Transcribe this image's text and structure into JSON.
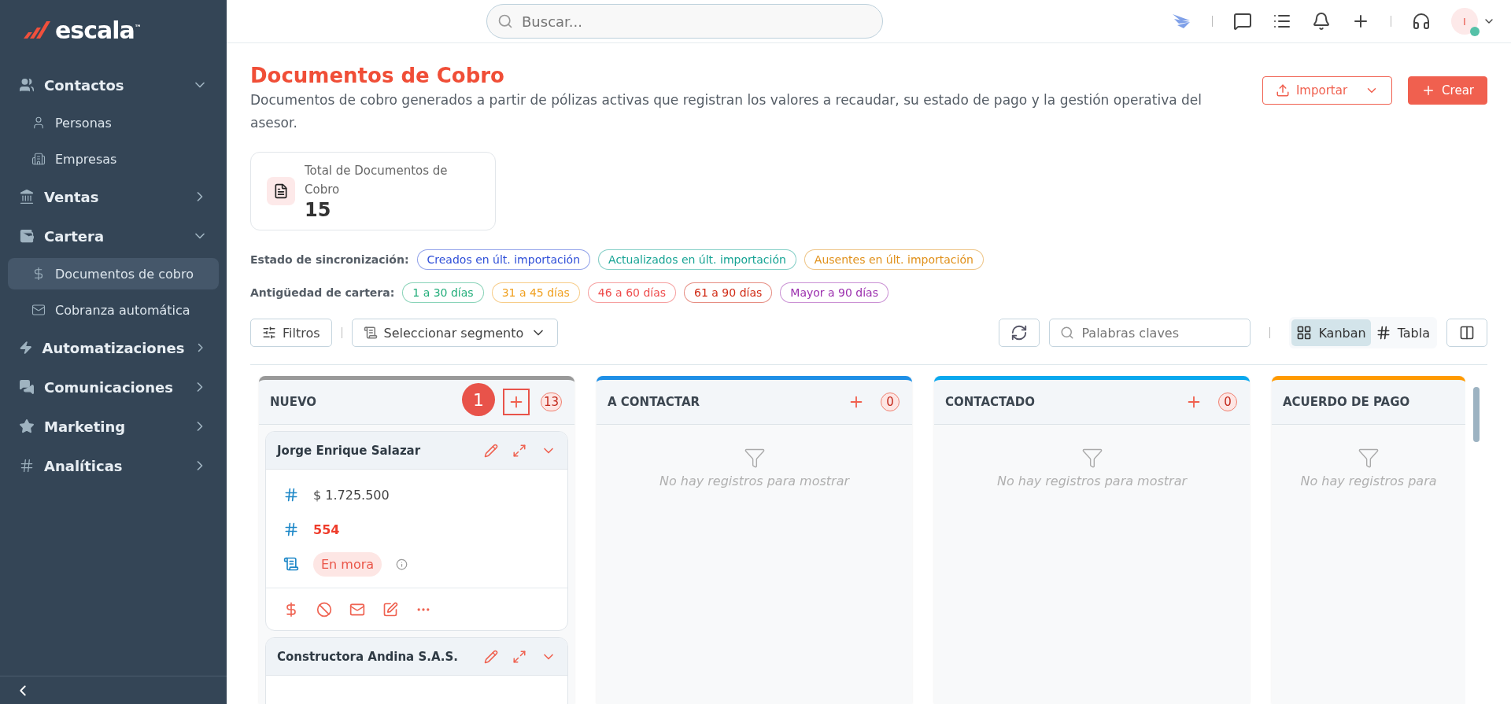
{
  "brand": {
    "name": "escala",
    "mark": "™"
  },
  "sidebar": {
    "items": [
      {
        "label": "Contactos",
        "expanded": true,
        "children": [
          {
            "label": "Personas",
            "selected": false
          },
          {
            "label": "Empresas",
            "selected": false
          }
        ]
      },
      {
        "label": "Ventas",
        "expanded": false
      },
      {
        "label": "Cartera",
        "expanded": true,
        "children": [
          {
            "label": "Documentos de cobro",
            "selected": true
          },
          {
            "label": "Cobranza automática",
            "selected": false
          }
        ]
      },
      {
        "label": "Automatizaciones",
        "expanded": false
      },
      {
        "label": "Comunicaciones",
        "expanded": false
      },
      {
        "label": "Marketing",
        "expanded": false
      },
      {
        "label": "Analíticas",
        "expanded": false
      }
    ]
  },
  "search": {
    "placeholder": "Buscar..."
  },
  "user": {
    "initial": "I",
    "online": true
  },
  "page": {
    "title": "Documentos de Cobro",
    "description": "Documentos de cobro generados a partir de pólizas activas que registran los valores a recaudar, su estado de pago y la gestión operativa del asesor.",
    "buttons": [
      {
        "label": "Importar",
        "kind": "outline"
      },
      {
        "label": "Crear",
        "kind": "primary"
      }
    ]
  },
  "stat": {
    "label": "Total de Documentos de Cobro",
    "value": "15"
  },
  "filter_rows": [
    {
      "label": "Estado de sincronización:",
      "chips": [
        {
          "label": "Creados en últ. importación",
          "color": "#2f4fd8"
        },
        {
          "label": "Actualizados en últ. importación",
          "color": "#16a394"
        },
        {
          "label": "Ausentes en últ. importación",
          "color": "#e0901a"
        }
      ]
    },
    {
      "label": "Antigüedad de cartera:",
      "chips": [
        {
          "label": "1 a 30 días",
          "color": "#22ad7a"
        },
        {
          "label": "31 a 45 días",
          "color": "#f0a020"
        },
        {
          "label": "46 a 60 días",
          "color": "#ee4b4b"
        },
        {
          "label": "61 a 90 días",
          "color": "#d02a14"
        },
        {
          "label": "Mayor a 90 días",
          "color": "#9b2fae"
        }
      ]
    }
  ],
  "toolbar": {
    "filters": "Filtros",
    "segment": "Seleccionar segmento",
    "keywords_placeholder": "Palabras claves",
    "views": [
      {
        "label": "Kanban",
        "selected": true
      },
      {
        "label": "Tabla",
        "selected": false
      }
    ]
  },
  "columns": [
    {
      "title": "NUEVO",
      "color": "#999999",
      "count": "13",
      "step": "1",
      "cards": [
        {
          "name": "Jorge Enrique Salazar",
          "fields": [
            {
              "kind": "amount",
              "value": "$ 1.725.500"
            },
            {
              "kind": "number",
              "value": "554"
            },
            {
              "kind": "status",
              "value": "En mora"
            }
          ]
        },
        {
          "name": "Constructora Andina S.A.S."
        }
      ]
    },
    {
      "title": "A CONTACTAR",
      "color": "#1e8fe6",
      "count": "0",
      "empty": "No hay registros para mostrar"
    },
    {
      "title": "CONTACTADO",
      "color": "#0aa8ee",
      "count": "0",
      "empty": "No hay registros para mostrar"
    },
    {
      "title": "ACUERDO DE PAGO",
      "color": "#ff9a00",
      "empty": "No hay registros para"
    }
  ]
}
